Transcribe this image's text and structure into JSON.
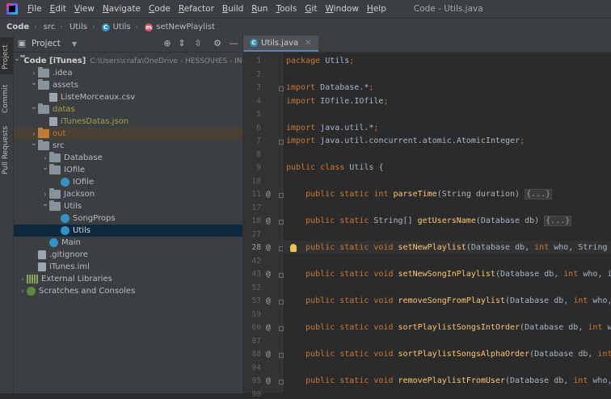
{
  "window": {
    "title": "Code - Utils.java"
  },
  "menu": [
    "File",
    "Edit",
    "View",
    "Navigate",
    "Code",
    "Refactor",
    "Build",
    "Run",
    "Tools",
    "Git",
    "Window",
    "Help"
  ],
  "menu_underline": [
    "F",
    "E",
    "V",
    "N",
    "C",
    "R",
    "B",
    "R",
    "T",
    "G",
    "W",
    "H"
  ],
  "breadcrumb": {
    "items": [
      "Code",
      "src",
      "Utils",
      "Utils",
      "setNewPlaylist"
    ]
  },
  "left_strip": {
    "tabs": [
      "Project",
      "Commit",
      "Pull Requests"
    ]
  },
  "project_panel": {
    "title": "Project",
    "tree": [
      {
        "label": "Code [iTunes]",
        "extra": "C:\\Users\\crafa\\OneDrive - HESSO\\HES - INFO G",
        "depth": 0,
        "arrow": "open",
        "icon": "folder"
      },
      {
        "label": ".idea",
        "depth": 1,
        "arrow": "closed",
        "icon": "folder"
      },
      {
        "label": "assets",
        "depth": 1,
        "arrow": "open",
        "icon": "folder"
      },
      {
        "label": "ListeMorceaux.csv",
        "depth": 2,
        "arrow": "",
        "icon": "file"
      },
      {
        "label": "datas",
        "depth": 1,
        "arrow": "open",
        "icon": "folder",
        "color": "#a5a047"
      },
      {
        "label": "iTunesDatas.json",
        "depth": 2,
        "arrow": "",
        "icon": "file",
        "color": "#a5a047"
      },
      {
        "label": "out",
        "depth": 1,
        "arrow": "closed",
        "icon": "folder-orange",
        "color": "#c07a3a",
        "hl": "out"
      },
      {
        "label": "src",
        "depth": 1,
        "arrow": "open",
        "icon": "folder"
      },
      {
        "label": "Database",
        "depth": 2,
        "arrow": "closed",
        "icon": "folder"
      },
      {
        "label": "IOfile",
        "depth": 2,
        "arrow": "open",
        "icon": "folder"
      },
      {
        "label": "IOfile",
        "depth": 3,
        "arrow": "",
        "icon": "class"
      },
      {
        "label": "Jackson",
        "depth": 2,
        "arrow": "closed",
        "icon": "folder"
      },
      {
        "label": "Utils",
        "depth": 2,
        "arrow": "open",
        "icon": "folder"
      },
      {
        "label": "SongProps",
        "depth": 3,
        "arrow": "",
        "icon": "class"
      },
      {
        "label": "Utils",
        "depth": 3,
        "arrow": "",
        "icon": "class",
        "hl": "selected"
      },
      {
        "label": "Main",
        "depth": 2,
        "arrow": "",
        "icon": "class"
      },
      {
        "label": ".gitignore",
        "depth": 1,
        "arrow": "",
        "icon": "file"
      },
      {
        "label": "iTunes.iml",
        "depth": 1,
        "arrow": "",
        "icon": "file"
      },
      {
        "label": "External Libraries",
        "depth": 0,
        "arrow": "closed",
        "icon": "lib"
      },
      {
        "label": "Scratches and Consoles",
        "depth": 0,
        "arrow": "closed",
        "icon": "scratch"
      }
    ]
  },
  "editor": {
    "tab": "Utils.java",
    "current_line": "28",
    "lines": [
      {
        "n": "1",
        "code": "package Utils;"
      },
      {
        "n": "2",
        "code": ""
      },
      {
        "n": "3",
        "code": "import Database.*;",
        "fold": true
      },
      {
        "n": "4",
        "code": "import IOfile.IOfile;"
      },
      {
        "n": "5",
        "code": ""
      },
      {
        "n": "6",
        "code": "import java.util.*;"
      },
      {
        "n": "7",
        "code": "import java.util.concurrent.atomic.AtomicInteger;",
        "fold": true
      },
      {
        "n": "8",
        "code": ""
      },
      {
        "n": "9",
        "code": "public class Utils {"
      },
      {
        "n": "10",
        "code": ""
      },
      {
        "n": "11",
        "code": "    public static int parseTime(String duration) {...}",
        "at": true,
        "fold": true
      },
      {
        "n": "17",
        "code": ""
      },
      {
        "n": "18",
        "code": "    public static String[] getUsersName(Database db) {...}",
        "at": true,
        "fold": true
      },
      {
        "n": "27",
        "code": ""
      },
      {
        "n": "28",
        "code": "    public static void setNewPlaylist(Database db, int who, String",
        "at": true,
        "fold": true,
        "bulb": true
      },
      {
        "n": "42",
        "code": ""
      },
      {
        "n": "43",
        "code": "    public static void setNewSongInPlaylist(Database db, int who, i",
        "at": true,
        "fold": true
      },
      {
        "n": "52",
        "code": ""
      },
      {
        "n": "53",
        "code": "    public static void removeSongFromPlaylist(Database db, int who,",
        "at": true,
        "fold": true
      },
      {
        "n": "59",
        "code": ""
      },
      {
        "n": "60",
        "code": "    public static void sortPlaylistSongsIntOrder(Database db, int w",
        "at": true,
        "fold": true
      },
      {
        "n": "87",
        "code": ""
      },
      {
        "n": "88",
        "code": "    public static void sortPlaylistSongsAlphaOrder(Database db, int",
        "at": true,
        "fold": true
      },
      {
        "n": "94",
        "code": ""
      },
      {
        "n": "95",
        "code": "    public static void removePlaylistFromUser(Database db, int who,",
        "at": true,
        "fold": true
      },
      {
        "n": "99",
        "code": ""
      }
    ]
  }
}
